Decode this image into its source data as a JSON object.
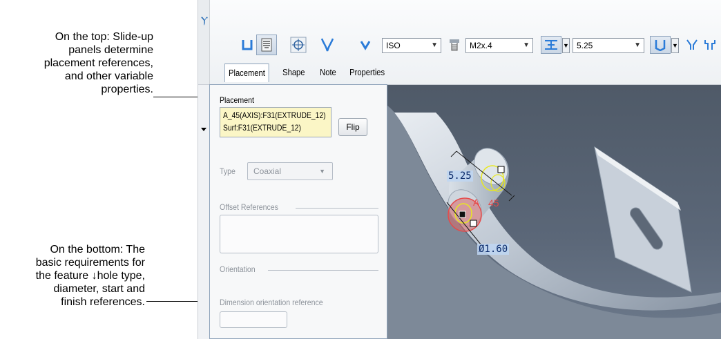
{
  "callouts": {
    "top": [
      "On the top: Slide-up",
      "panels determine",
      "placement references,",
      "and other variable",
      "properties."
    ],
    "bottom": [
      "On the bottom: The",
      "basic requirements for",
      "the feature ↓hole type,",
      "diameter, start and",
      "finish references."
    ]
  },
  "dashboard": {
    "standard": "ISO",
    "screw_size": "M2x.4",
    "depth_value": "5.25",
    "tabs": [
      "Placement",
      "Shape",
      "Note",
      "Properties"
    ],
    "active_tab": "Placement",
    "icons": [
      "simple-hole-icon",
      "standard-hole-icon",
      "sketch-hole-icon",
      "thread-icon",
      "tap-icon",
      "depth-blind-icon",
      "drill-depth-icon",
      "countersink-icon",
      "counterbore-icon"
    ]
  },
  "placement_panel": {
    "section_title": "Placement",
    "references": [
      "A_45(AXIS):F31(EXTRUDE_12)",
      "Surf:F31(EXTRUDE_12)"
    ],
    "flip_label": "Flip",
    "type_label": "Type",
    "type_value": "Coaxial",
    "offset_label": "Offset References",
    "orientation_label": "Orientation",
    "dimension_orientation_label": "Dimension orientation reference"
  },
  "model_annotations": {
    "depth": "5.25",
    "axis_name": "A",
    "axis_number": "45",
    "diameter": "Ø1.60"
  },
  "colors": {
    "panel_highlight": "#fbf6c6",
    "viewport_bg": "#56616f",
    "dimension_text": "#0b2b6b",
    "axis_label": "#e64a4a",
    "handle_yellow": "#e8e820"
  }
}
